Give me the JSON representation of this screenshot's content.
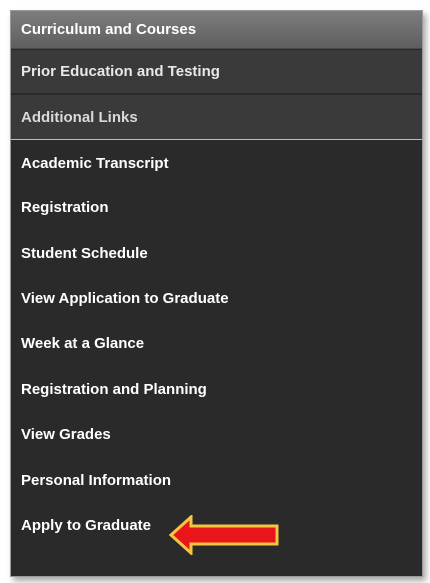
{
  "sections": {
    "curriculum": "Curriculum and Courses",
    "prior_education": "Prior Education and Testing",
    "additional_links": "Additional Links"
  },
  "links": [
    "Academic Transcript",
    "Registration",
    "Student Schedule",
    "View Application to Graduate",
    "Week at a Glance",
    "Registration and Planning",
    "View Grades",
    "Personal Information",
    "Apply to Graduate"
  ],
  "annotation": {
    "icon": "red-arrow-icon",
    "fill": "#e8151b",
    "outline": "#f5c542"
  }
}
